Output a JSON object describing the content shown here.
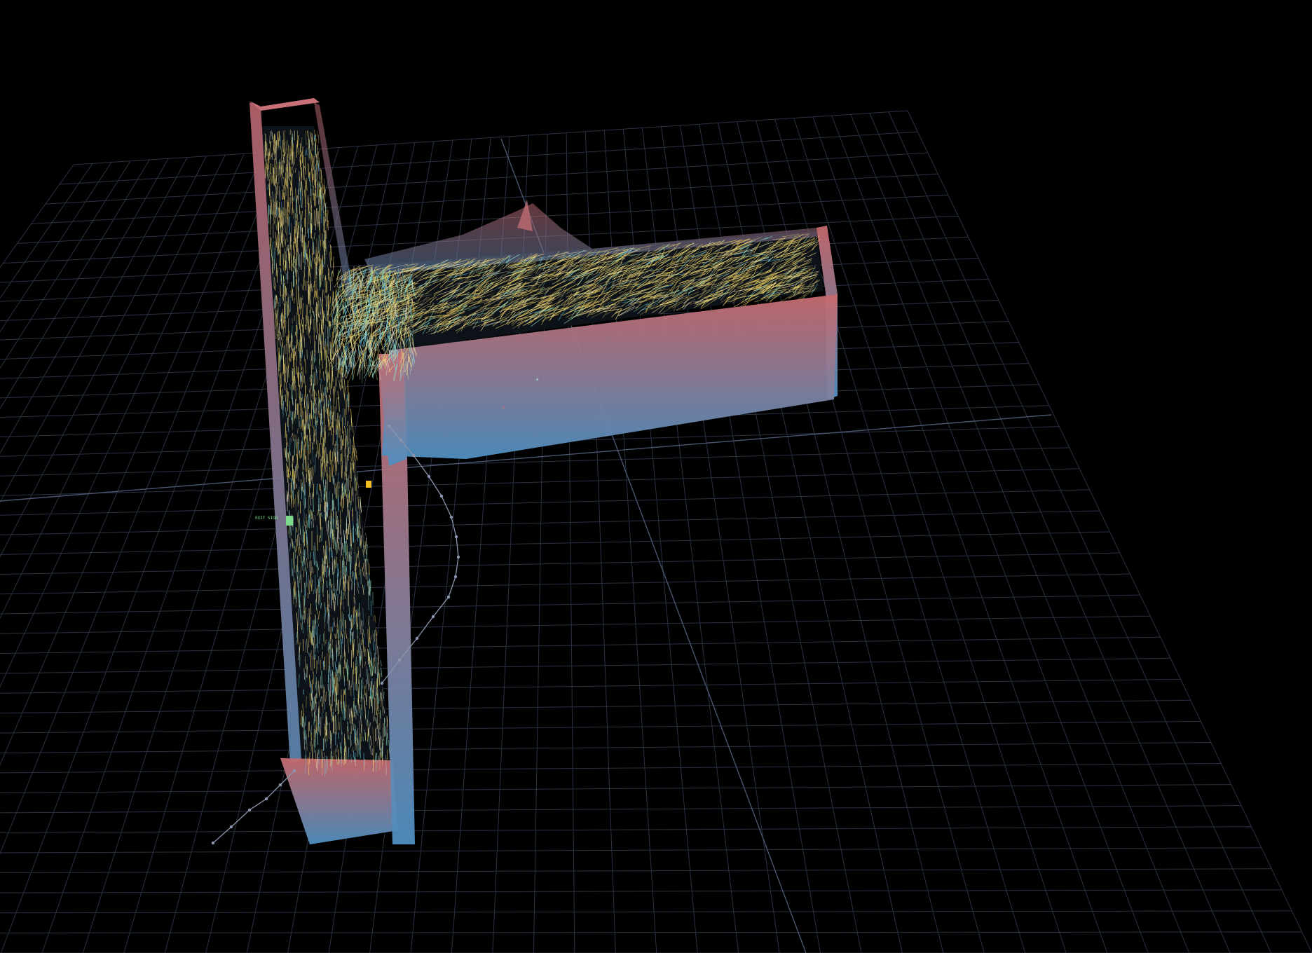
{
  "viewport": {
    "background": "#000000"
  },
  "scene": {
    "grid_color": "#2a3242",
    "axis_color": "#4a5670",
    "wall_top_color": "#c76a6e",
    "wall_bottom_color": "#4f8fc0",
    "floor_color": "#0d1218",
    "particle_colors": [
      "#f0d060",
      "#f5e28a",
      "#8fe0c0",
      "#6fd0e8",
      "#d8d0c0"
    ],
    "path_color": "#8a96ad",
    "markers": {
      "exit_sign_label": "EXIT SIGN",
      "exit_sign_color": "#7ddc8c",
      "marker_a_label": "✦",
      "marker_a_color": "#9ad8d0",
      "marker_b_label": "+",
      "marker_b_color": "#d07070",
      "waypoint_color": "#f0c020"
    }
  }
}
